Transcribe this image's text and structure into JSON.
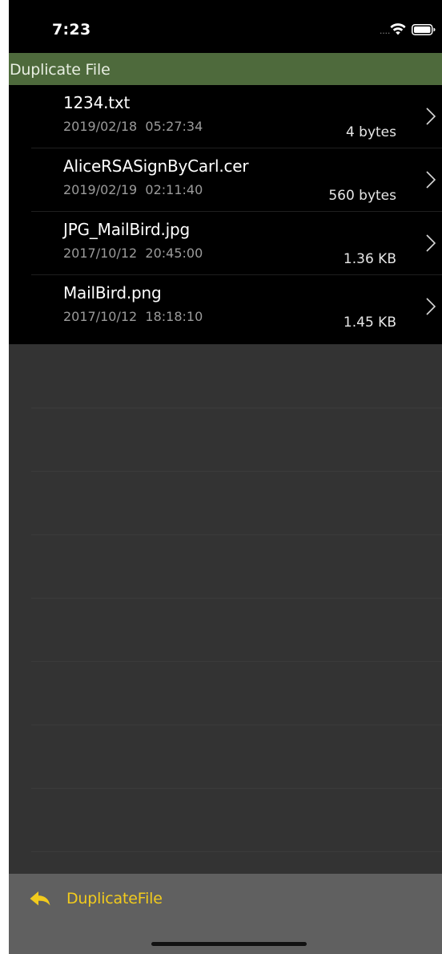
{
  "status_bar": {
    "time": "7:23",
    "signal": "....",
    "wifi_icon": "wifi-icon",
    "battery_icon": "battery-icon"
  },
  "nav": {
    "title": "Duplicate File",
    "background": "#4e6a3c"
  },
  "files": [
    {
      "name": "1234.txt",
      "date": "2019/02/18  05:27:34",
      "size": "4 bytes"
    },
    {
      "name": "AliceRSASignByCarl.cer",
      "date": "2019/02/19  02:11:40",
      "size": "560 bytes"
    },
    {
      "name": "JPG_MailBird.jpg",
      "date": "2017/10/12  20:45:00",
      "size": "1.36 KB"
    },
    {
      "name": "MailBird.png",
      "date": "2017/10/12  18:18:10",
      "size": "1.45 KB"
    }
  ],
  "toolbar": {
    "back_icon": "reply-arrow-icon",
    "back_label": "DuplicateFile",
    "accent": "#f2cb1d"
  }
}
